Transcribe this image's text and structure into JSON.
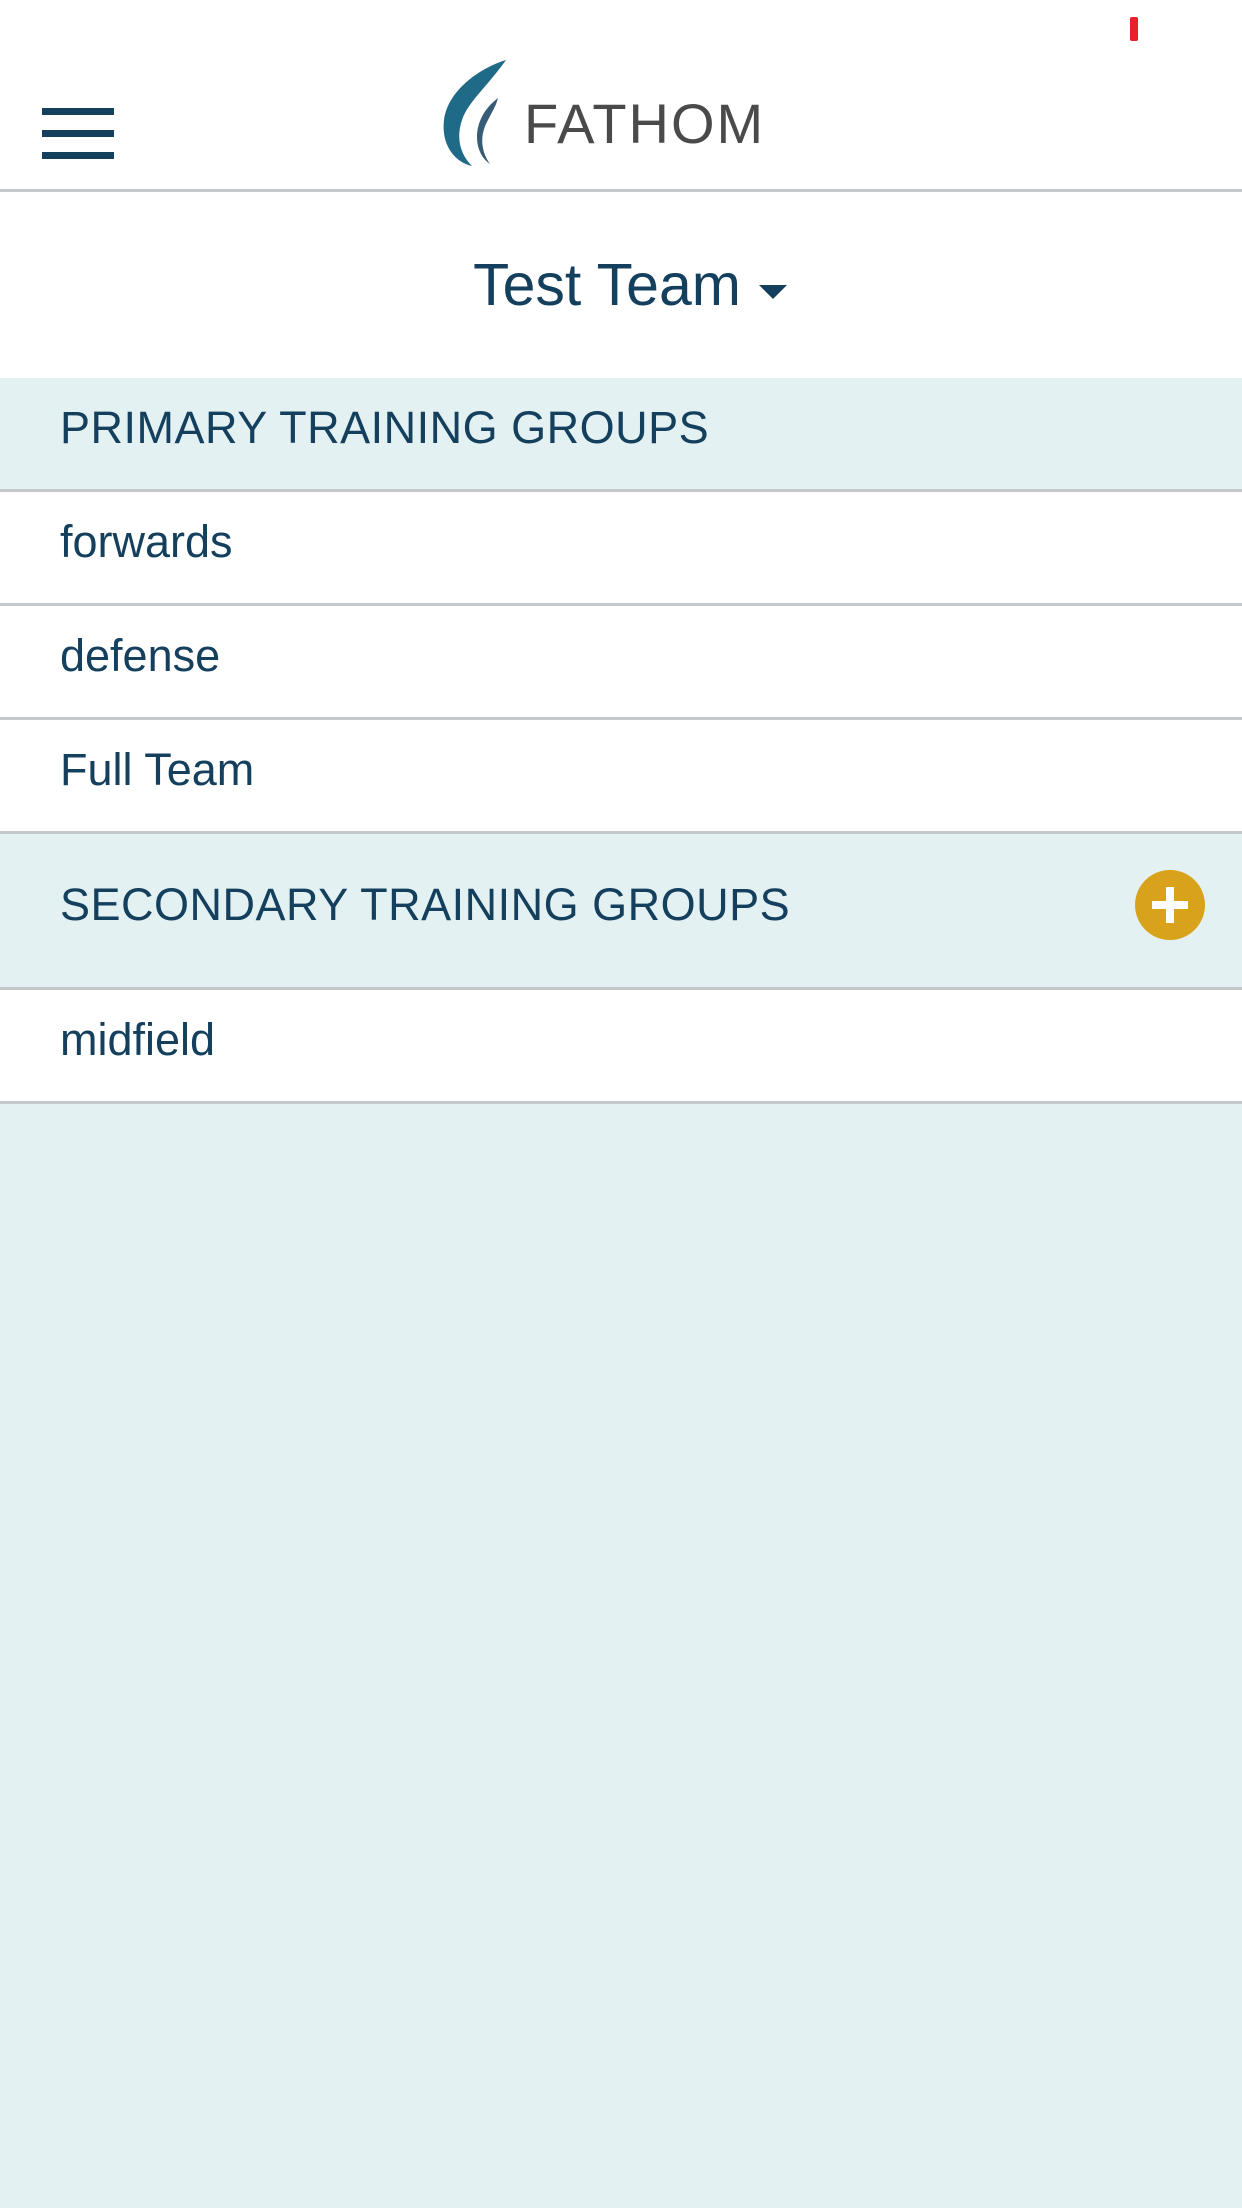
{
  "header": {
    "menu_icon": "hamburger-menu-icon",
    "logo_text": "FATHOM",
    "logo_icon": "fathom-leaf-logo",
    "brand_color": "#14405e"
  },
  "team_selector": {
    "team_name": "Test Team",
    "dropdown_icon": "caret-down-icon"
  },
  "primary_groups": {
    "title": "PRIMARY TRAINING GROUPS",
    "items": [
      {
        "label": "forwards"
      },
      {
        "label": "defense"
      },
      {
        "label": "Full Team"
      }
    ]
  },
  "secondary_groups": {
    "title": "SECONDARY TRAINING GROUPS",
    "add_icon": "plus-circle-icon",
    "add_color": "#d9a21b",
    "items": [
      {
        "label": "midfield"
      }
    ]
  }
}
